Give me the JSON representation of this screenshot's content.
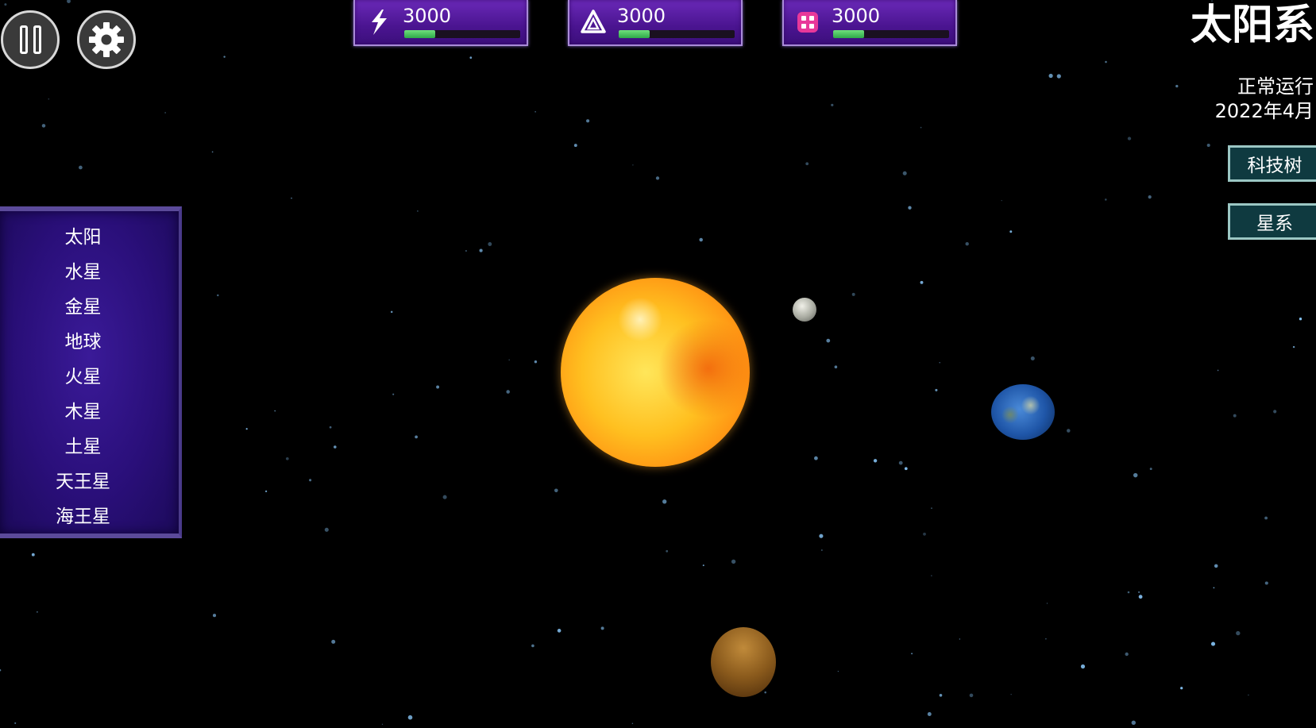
{
  "controls": {
    "pause_icon": "pause-icon",
    "settings_icon": "gear-icon"
  },
  "resources": [
    {
      "icon": "lightning-icon",
      "value": "3000",
      "progress": 0.27,
      "color": "#2ea84a"
    },
    {
      "icon": "triangle-knot-icon",
      "value": "3000",
      "progress": 0.27,
      "color": "#2ea84a"
    },
    {
      "icon": "chip-icon",
      "value": "3000",
      "progress": 0.27,
      "color": "#2ea84a"
    }
  ],
  "header": {
    "title": "太阳系",
    "status": "正常运行",
    "date": "2022年4月"
  },
  "side_buttons": {
    "tech_tree": "科技树",
    "galaxy": "星系"
  },
  "planet_list": [
    "太阳",
    "水星",
    "金星",
    "地球",
    "火星",
    "木星",
    "土星",
    "天王星",
    "海王星"
  ],
  "colors": {
    "panel": "#2a0f7a",
    "resource_panel": "#4a1490",
    "side_button": "#0f3a40",
    "sun": "#ffc020",
    "earth": "#1f56a8",
    "mars": "#8a5a1c"
  }
}
